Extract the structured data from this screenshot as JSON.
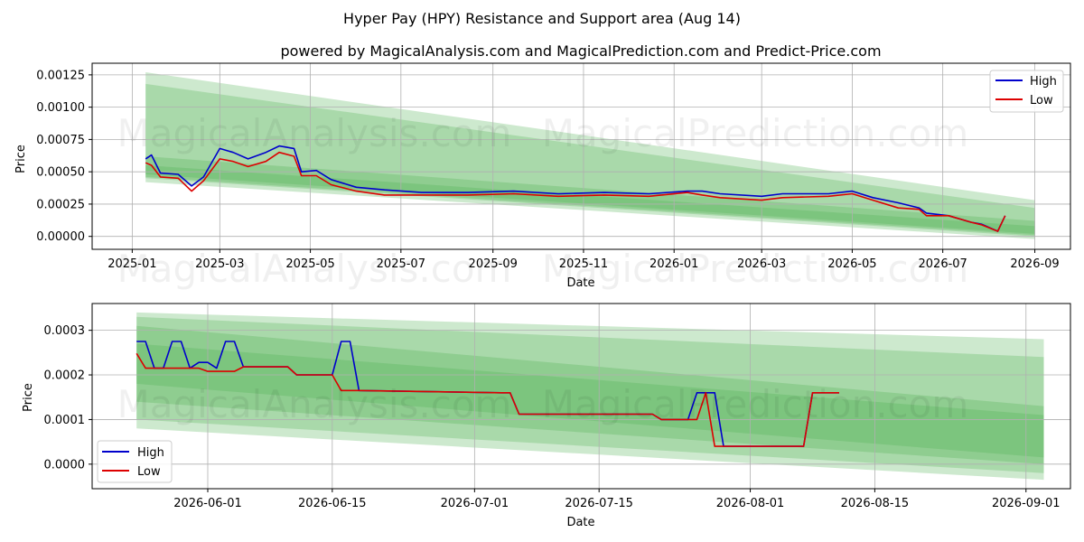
{
  "title": "Hyper Pay (HPY) Resistance and Support area (Aug 14)",
  "subtitle": "powered by MagicalAnalysis.com and MagicalPrediction.com and Predict-Price.com",
  "watermarks": [
    "MagicalAnalysis.com",
    "MagicalPrediction.com"
  ],
  "colors": {
    "high": "#0000cc",
    "low": "#dd0000",
    "band": "#4caf50",
    "grid": "#b0b0b0"
  },
  "chart_data": [
    {
      "type": "line",
      "xlabel": "Date",
      "ylabel": "Price",
      "legend_position": "top-right",
      "grid": true,
      "x_tick_labels": [
        "2025-01",
        "2025-03",
        "2025-05",
        "2025-07",
        "2025-09",
        "2025-11",
        "2026-01",
        "2026-03",
        "2026-05",
        "2026-07",
        "2026-09"
      ],
      "y_tick_labels": [
        "0.00000",
        "0.00025",
        "0.00050",
        "0.00075",
        "0.00100",
        "0.00125"
      ],
      "ylim": [
        -0.0001,
        0.00134
      ],
      "series": [
        {
          "name": "High",
          "x": [
            "2025-01-10",
            "2025-01-14",
            "2025-01-20",
            "2025-02-01",
            "2025-02-10",
            "2025-02-18",
            "2025-03-01",
            "2025-03-10",
            "2025-03-20",
            "2025-04-01",
            "2025-04-10",
            "2025-04-20",
            "2025-04-25",
            "2025-05-05",
            "2025-05-15",
            "2025-06-01",
            "2025-06-20",
            "2025-07-15",
            "2025-08-15",
            "2025-09-15",
            "2025-10-15",
            "2025-11-15",
            "2025-12-15",
            "2026-01-10",
            "2026-01-20",
            "2026-02-01",
            "2026-03-01",
            "2026-03-15",
            "2026-04-15",
            "2026-05-01",
            "2026-05-15",
            "2026-06-01",
            "2026-06-15",
            "2026-06-20",
            "2026-07-05",
            "2026-07-20",
            "2026-07-27",
            "2026-08-07",
            "2026-08-12"
          ],
          "values": [
            0.0006,
            0.00063,
            0.00049,
            0.00048,
            0.00039,
            0.00046,
            0.00068,
            0.00065,
            0.0006,
            0.00065,
            0.0007,
            0.00068,
            0.0005,
            0.00051,
            0.00044,
            0.00038,
            0.00036,
            0.00034,
            0.00034,
            0.00035,
            0.00033,
            0.00034,
            0.00033,
            0.00035,
            0.00035,
            0.00033,
            0.00031,
            0.00033,
            0.00033,
            0.00035,
            0.0003,
            0.00026,
            0.00022,
            0.00018,
            0.00016,
            0.00011,
            9.5e-05,
            4e-05,
            0.00016
          ]
        },
        {
          "name": "Low",
          "x": [
            "2025-01-10",
            "2025-01-14",
            "2025-01-20",
            "2025-02-01",
            "2025-02-10",
            "2025-02-18",
            "2025-03-01",
            "2025-03-10",
            "2025-03-20",
            "2025-04-01",
            "2025-04-10",
            "2025-04-20",
            "2025-04-25",
            "2025-05-05",
            "2025-05-15",
            "2025-06-01",
            "2025-06-20",
            "2025-07-15",
            "2025-08-15",
            "2025-09-15",
            "2025-10-15",
            "2025-11-15",
            "2025-12-15",
            "2026-01-10",
            "2026-01-20",
            "2026-02-01",
            "2026-03-01",
            "2026-03-15",
            "2026-04-15",
            "2026-05-01",
            "2026-05-15",
            "2026-06-01",
            "2026-06-15",
            "2026-06-20",
            "2026-07-05",
            "2026-07-20",
            "2026-07-27",
            "2026-08-07",
            "2026-08-12"
          ],
          "values": [
            0.00057,
            0.00055,
            0.00046,
            0.00045,
            0.00035,
            0.00043,
            0.0006,
            0.00058,
            0.00054,
            0.00058,
            0.00065,
            0.00062,
            0.00047,
            0.00047,
            0.0004,
            0.00035,
            0.00032,
            0.00032,
            0.00032,
            0.00033,
            0.00031,
            0.00032,
            0.00031,
            0.00034,
            0.00032,
            0.0003,
            0.00028,
            0.0003,
            0.00031,
            0.00033,
            0.00028,
            0.00022,
            0.00021,
            0.00016,
            0.00016,
            0.00011,
            9e-05,
            4e-05,
            0.00016
          ]
        }
      ],
      "bands": [
        {
          "x": [
            "2025-01-10",
            "2026-09-01"
          ],
          "upper": [
            0.00127,
            0.00028
          ],
          "lower": [
            0.00042,
            -2e-05
          ]
        },
        {
          "x": [
            "2025-01-10",
            "2026-09-01"
          ],
          "upper": [
            0.00118,
            0.00022
          ],
          "lower": [
            0.00045,
            0.0
          ]
        },
        {
          "x": [
            "2025-01-10",
            "2026-09-01"
          ],
          "upper": [
            0.00062,
            0.00012
          ],
          "lower": [
            0.00046,
            1e-05
          ]
        },
        {
          "x": [
            "2025-01-10",
            "2026-09-01"
          ],
          "upper": [
            0.00055,
            8e-05
          ],
          "lower": [
            0.00048,
            2e-05
          ]
        }
      ]
    },
    {
      "type": "line",
      "xlabel": "Date",
      "ylabel": "Price",
      "legend_position": "bottom-left",
      "grid": true,
      "x_tick_labels": [
        "2026-06-01",
        "2026-06-15",
        "2026-07-01",
        "2026-07-15",
        "2026-08-01",
        "2026-08-15",
        "2026-09-01"
      ],
      "y_tick_labels": [
        "0.0000",
        "0.0001",
        "0.0002",
        "0.0003"
      ],
      "ylim": [
        -5.5e-05,
        0.00036
      ],
      "series": [
        {
          "name": "High",
          "x": [
            "2026-05-24",
            "2026-05-25",
            "2026-05-26",
            "2026-05-27",
            "2026-05-28",
            "2026-05-29",
            "2026-05-30",
            "2026-05-31",
            "2026-06-01",
            "2026-06-02",
            "2026-06-03",
            "2026-06-04",
            "2026-06-05",
            "2026-06-06",
            "2026-06-07",
            "2026-06-10",
            "2026-06-11",
            "2026-06-14",
            "2026-06-15",
            "2026-06-16",
            "2026-06-17",
            "2026-06-18",
            "2026-07-04",
            "2026-07-05",
            "2026-07-06",
            "2026-07-21",
            "2026-07-22",
            "2026-07-25",
            "2026-07-26",
            "2026-07-27",
            "2026-07-28",
            "2026-07-29",
            "2026-08-06",
            "2026-08-07",
            "2026-08-08",
            "2026-08-11"
          ],
          "values": [
            0.000275,
            0.000275,
            0.000215,
            0.000215,
            0.000275,
            0.000275,
            0.000215,
            0.000228,
            0.000228,
            0.000215,
            0.000275,
            0.000275,
            0.000218,
            0.000218,
            0.000218,
            0.000218,
            0.0002,
            0.0002,
            0.0002,
            0.000275,
            0.000275,
            0.000165,
            0.00016,
            0.00016,
            0.000112,
            0.000112,
            0.0001,
            0.0001,
            0.00016,
            0.00016,
            0.00016,
            4e-05,
            4e-05,
            4e-05,
            0.00016,
            0.00016
          ]
        },
        {
          "name": "Low",
          "x": [
            "2026-05-24",
            "2026-05-25",
            "2026-05-26",
            "2026-05-27",
            "2026-05-28",
            "2026-05-29",
            "2026-05-30",
            "2026-05-31",
            "2026-06-01",
            "2026-06-02",
            "2026-06-03",
            "2026-06-04",
            "2026-06-05",
            "2026-06-07",
            "2026-06-08",
            "2026-06-10",
            "2026-06-11",
            "2026-06-14",
            "2026-06-15",
            "2026-06-16",
            "2026-06-17",
            "2026-06-18",
            "2026-07-04",
            "2026-07-05",
            "2026-07-06",
            "2026-07-21",
            "2026-07-22",
            "2026-07-25",
            "2026-07-26",
            "2026-07-27",
            "2026-07-28",
            "2026-07-29",
            "2026-08-06",
            "2026-08-07",
            "2026-08-08",
            "2026-08-11"
          ],
          "values": [
            0.000248,
            0.000215,
            0.000215,
            0.000215,
            0.000215,
            0.000215,
            0.000215,
            0.000215,
            0.000208,
            0.000208,
            0.000208,
            0.000208,
            0.000218,
            0.000218,
            0.000218,
            0.000218,
            0.0002,
            0.0002,
            0.0002,
            0.000165,
            0.000165,
            0.000165,
            0.00016,
            0.00016,
            0.000112,
            0.000112,
            0.0001,
            0.0001,
            0.0001,
            0.00016,
            4e-05,
            4e-05,
            4e-05,
            4e-05,
            0.00016,
            0.00016
          ]
        }
      ],
      "bands": [
        {
          "x": [
            "2026-05-24",
            "2026-09-03"
          ],
          "upper": [
            0.00034,
            0.00028
          ],
          "lower": [
            8e-05,
            -3.5e-05
          ]
        },
        {
          "x": [
            "2026-05-24",
            "2026-09-03"
          ],
          "upper": [
            0.00033,
            0.00024
          ],
          "lower": [
            0.0001,
            -2e-05
          ]
        },
        {
          "x": [
            "2026-05-24",
            "2026-09-03"
          ],
          "upper": [
            0.00031,
            0.00013
          ],
          "lower": [
            0.00014,
            0.0
          ]
        },
        {
          "x": [
            "2026-05-24",
            "2026-09-03"
          ],
          "upper": [
            0.00027,
            0.00011
          ],
          "lower": [
            0.00018,
            1.5e-05
          ]
        }
      ]
    }
  ]
}
